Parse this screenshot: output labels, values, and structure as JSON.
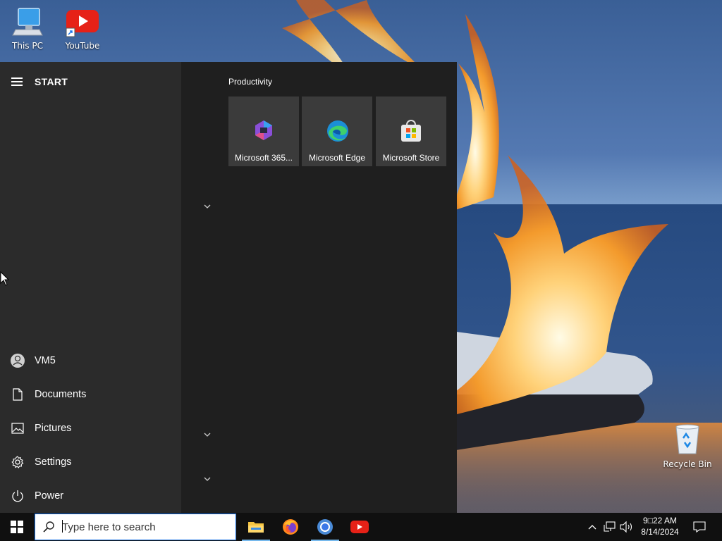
{
  "desktop": {
    "icons": [
      {
        "label": "This PC",
        "icon": "this-pc-icon"
      },
      {
        "label": "YouTube",
        "icon": "youtube-icon"
      },
      {
        "label": "Recycle Bin",
        "icon": "recycle-bin-icon"
      }
    ]
  },
  "start_menu": {
    "title": "START",
    "left_items": [
      {
        "label": "VM5",
        "icon": "user-avatar-icon"
      },
      {
        "label": "Documents",
        "icon": "document-icon"
      },
      {
        "label": "Pictures",
        "icon": "pictures-icon"
      },
      {
        "label": "Settings",
        "icon": "gear-icon"
      },
      {
        "label": "Power",
        "icon": "power-icon"
      }
    ],
    "group_title": "Productivity",
    "tiles": [
      {
        "label": "Microsoft 365...",
        "icon": "microsoft-365-icon"
      },
      {
        "label": "Microsoft Edge",
        "icon": "edge-icon"
      },
      {
        "label": "Microsoft Store",
        "icon": "store-icon"
      }
    ]
  },
  "taskbar": {
    "search_placeholder": "Type here to search",
    "apps": [
      {
        "name": "File Explorer",
        "icon": "file-explorer-icon"
      },
      {
        "name": "Firefox",
        "icon": "firefox-icon"
      },
      {
        "name": "Chrome",
        "icon": "chrome-icon"
      },
      {
        "name": "YouTube",
        "icon": "youtube-icon"
      }
    ],
    "time": "9□22 AM",
    "date": "8/14/2024"
  },
  "colors": {
    "start_left_bg": "#2b2b2b",
    "start_right_bg": "#1f1f1f",
    "tile_bg": "#3b3b3b",
    "taskbar_bg": "#101010",
    "accent": "#76b9ed"
  }
}
